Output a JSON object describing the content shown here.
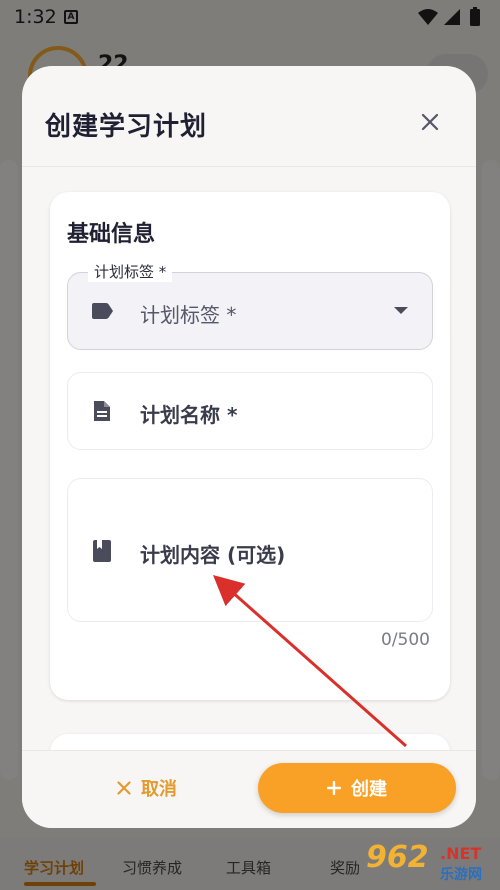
{
  "status_bar": {
    "time": "1:32",
    "notification_glyph": "A"
  },
  "background": {
    "profile_number": "22",
    "bottom_nav": [
      {
        "label": "学习计划",
        "active": true
      },
      {
        "label": "习惯养成",
        "active": false
      },
      {
        "label": "工具箱",
        "active": false
      },
      {
        "label": "奖励",
        "active": false
      }
    ]
  },
  "dialog": {
    "title": "创建学习计划",
    "section_title": "基础信息",
    "tag_field": {
      "floating_label": "计划标签 *",
      "placeholder": "计划标签 *",
      "icon": "label-icon"
    },
    "name_field": {
      "placeholder": "计划名称 *",
      "icon": "document-icon"
    },
    "content_field": {
      "placeholder": "计划内容 (可选)",
      "icon": "book-icon",
      "counter": "0/500"
    },
    "cancel_label": "取消",
    "create_label": "创建"
  },
  "watermark": {
    "number": "962",
    "domain": ".NET",
    "sub": "乐游网"
  },
  "colors": {
    "accent": "#f9a126",
    "accent_text": "#e39a2e",
    "annotation_arrow": "#d9302b"
  }
}
